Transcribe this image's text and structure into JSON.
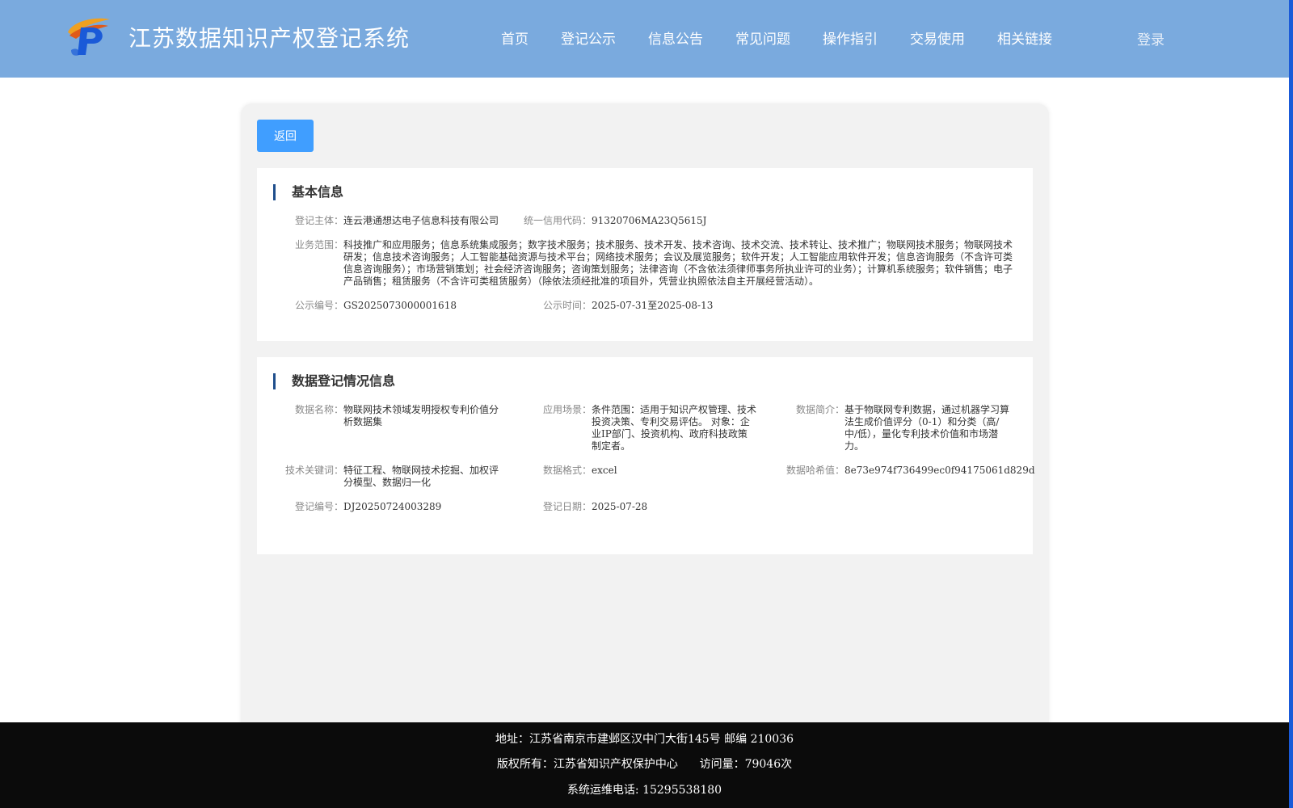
{
  "header": {
    "title": "江苏数据知识产权登记系统",
    "nav": [
      "首页",
      "登记公示",
      "信息公告",
      "常见问题",
      "操作指引",
      "交易使用",
      "相关链接"
    ],
    "login": "登录"
  },
  "back_button": "返回",
  "basic": {
    "title": "基本信息",
    "subject_label": "登记主体：",
    "subject": "连云港通想达电子信息科技有限公司",
    "credit_label": "统一信用代码：",
    "credit": "91320706MA23Q5615J",
    "scope_label": "业务范围：",
    "scope": "科技推广和应用服务；信息系统集成服务；数字技术服务；技术服务、技术开发、技术咨询、技术交流、技术转让、技术推广；物联网技术服务；物联网技术研发；信息技术咨询服务；人工智能基础资源与技术平台；网络技术服务；会议及展览服务；软件开发；人工智能应用软件开发；信息咨询服务（不含许可类信息咨询服务）；市场营销策划；社会经济咨询服务；咨询策划服务；法律咨询（不含依法须律师事务所执业许可的业务）；计算机系统服务；软件销售；电子产品销售；租赁服务（不含许可类租赁服务）（除依法须经批准的项目外，凭营业执照依法自主开展经营活动）。",
    "pub_no_label": "公示编号：",
    "pub_no": "GS2025073000001618",
    "pub_time_label": "公示时间：",
    "pub_time": "2025-07-31至2025-08-13"
  },
  "registration": {
    "title": "数据登记情况信息",
    "name_label": "数据名称：",
    "name": "物联网技术领域发明授权专利价值分析数据集",
    "scene_label": "应用场景：",
    "scene": "条件范围：适用于知识产权管理、技术投资决策、专利交易评估。 对象：企业IP部门、投资机构、政府科技政策制定者。",
    "intro_label": "数据简介：",
    "intro": "基于物联网专利数据，通过机器学习算法生成价值评分（0-1）和分类（高/中/低），量化专利技术价值和市场潜力。",
    "keywords_label": "技术关键词：",
    "keywords": "特征工程、物联网技术挖掘、加权评分模型、数据归一化",
    "format_label": "数据格式：",
    "format": "excel",
    "hash_label": "数据哈希值：",
    "hash": "8e73e974f736499ec0f94175061d829d",
    "reg_no_label": "登记编号：",
    "reg_no": "DJ20250724003289",
    "reg_date_label": "登记日期：",
    "reg_date": "2025-07-28"
  },
  "footer": {
    "address": "地址：江苏省南京市建邺区汉中门大街145号 邮编 210036",
    "copyright": "版权所有：江苏省知识产权保护中心      访问量：79046次",
    "phone": "系统运维电话: 15295538180"
  }
}
